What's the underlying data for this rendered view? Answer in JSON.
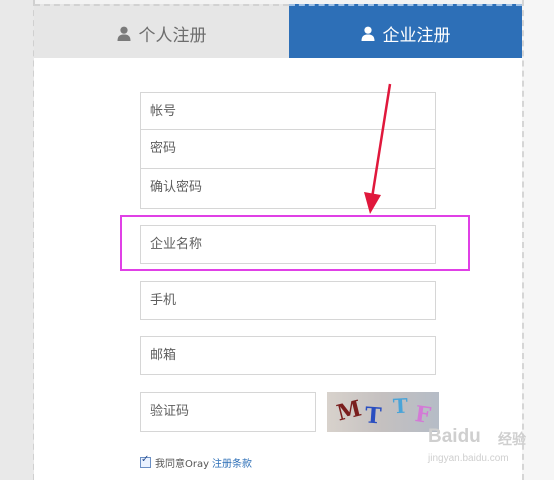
{
  "tabs": [
    {
      "label": "个人注册",
      "icon": "user-icon",
      "active": false
    },
    {
      "label": "企业注册",
      "icon": "user-icon",
      "active": true
    }
  ],
  "form": {
    "account_placeholder": "帐号",
    "password_placeholder": "密码",
    "confirm_password_placeholder": "确认密码",
    "company_name_placeholder": "企业名称",
    "phone_placeholder": "手机",
    "email_placeholder": "邮箱",
    "captcha_placeholder": "验证码",
    "captcha_chars": [
      "M",
      "T",
      "T",
      "F"
    ],
    "agree_checked": true,
    "agree_text": "我同意Oray",
    "agree_link": "注册条款"
  },
  "watermark": {
    "brand": "Baidu",
    "brand_cn": "经验",
    "url": "jingyan.baidu.com"
  },
  "colors": {
    "accent": "#2d6fb7",
    "highlight": "#e040e6",
    "annotation_arrow": "#e0183c"
  }
}
